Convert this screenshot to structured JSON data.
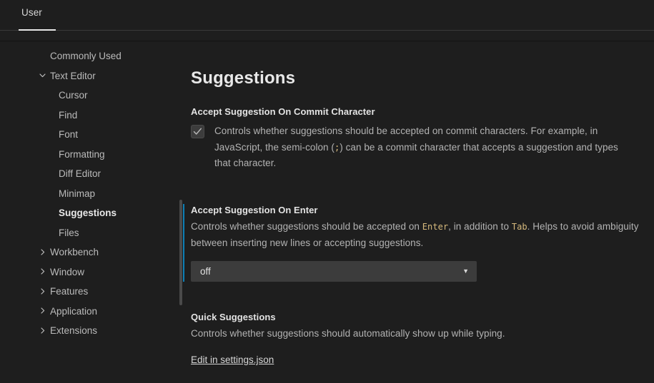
{
  "window": {
    "background": "#1e1e1e",
    "accent_focus_color": "#0e7fb5",
    "code_color": "#d7ba7d"
  },
  "tabs": {
    "items": [
      {
        "label": "User",
        "active": true
      }
    ]
  },
  "sidebar": {
    "items": [
      {
        "label": "Commonly Used",
        "level": "top",
        "twisty": "none",
        "selected": false
      },
      {
        "label": "Text Editor",
        "level": "group",
        "twisty": "chevron-down",
        "selected": false
      },
      {
        "label": "Cursor",
        "level": "child",
        "twisty": "none",
        "selected": false
      },
      {
        "label": "Find",
        "level": "child",
        "twisty": "none",
        "selected": false
      },
      {
        "label": "Font",
        "level": "child",
        "twisty": "none",
        "selected": false
      },
      {
        "label": "Formatting",
        "level": "child",
        "twisty": "none",
        "selected": false
      },
      {
        "label": "Diff Editor",
        "level": "child",
        "twisty": "none",
        "selected": false
      },
      {
        "label": "Minimap",
        "level": "child",
        "twisty": "none",
        "selected": false
      },
      {
        "label": "Suggestions",
        "level": "child",
        "twisty": "none",
        "selected": true
      },
      {
        "label": "Files",
        "level": "child",
        "twisty": "none",
        "selected": false
      },
      {
        "label": "Workbench",
        "level": "group",
        "twisty": "chevron-right",
        "selected": false
      },
      {
        "label": "Window",
        "level": "group",
        "twisty": "chevron-right",
        "selected": false
      },
      {
        "label": "Features",
        "level": "group",
        "twisty": "chevron-right",
        "selected": false
      },
      {
        "label": "Application",
        "level": "group",
        "twisty": "chevron-right",
        "selected": false
      },
      {
        "label": "Extensions",
        "level": "group",
        "twisty": "chevron-right",
        "selected": false
      }
    ]
  },
  "content": {
    "page_title": "Suggestions",
    "settings": [
      {
        "id": "accept-suggestion-on-commit-character",
        "title": "Accept Suggestion On Commit Character",
        "control": "checkbox",
        "checked": true,
        "description_parts": [
          {
            "type": "text",
            "text": "Controls whether suggestions should be accepted on commit characters. For example, in JavaScript, the semi-colon ("
          },
          {
            "type": "code",
            "text": ";"
          },
          {
            "type": "text",
            "text": ") can be a commit character that accepts a suggestion and types that character."
          }
        ],
        "focused": false
      },
      {
        "id": "accept-suggestion-on-enter",
        "title": "Accept Suggestion On Enter",
        "control": "dropdown",
        "value": "off",
        "description_parts": [
          {
            "type": "text",
            "text": "Controls whether suggestions should be accepted on "
          },
          {
            "type": "code",
            "text": "Enter"
          },
          {
            "type": "text",
            "text": ", in addition to "
          },
          {
            "type": "code",
            "text": "Tab"
          },
          {
            "type": "text",
            "text": ". Helps to avoid ambiguity between inserting new lines or accepting suggestions."
          }
        ],
        "focused": true
      },
      {
        "id": "quick-suggestions",
        "title": "Quick Suggestions",
        "control": "none",
        "description_parts": [
          {
            "type": "text",
            "text": "Controls whether suggestions should automatically show up while typing."
          }
        ],
        "focused": false
      }
    ],
    "edit_link_label": "Edit in settings.json"
  }
}
